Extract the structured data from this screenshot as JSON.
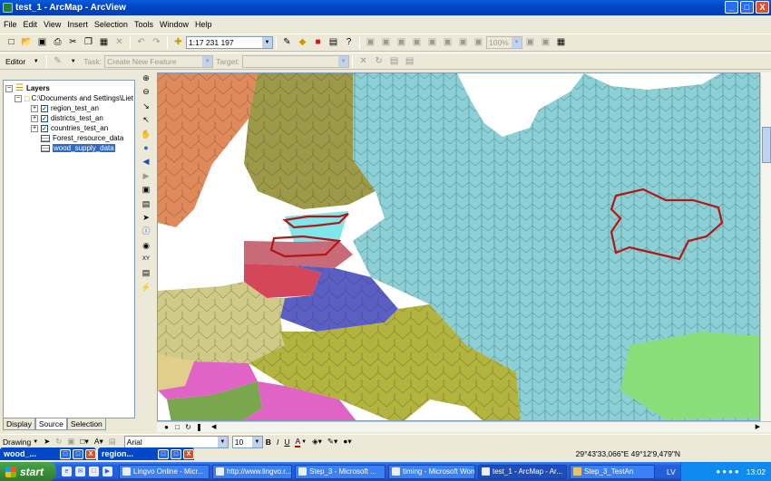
{
  "window": {
    "title": "test_1 - ArcMap - ArcView",
    "buttons": {
      "minimize": "_",
      "maximize": "□",
      "close": "X"
    }
  },
  "menu": [
    "File",
    "Edit",
    "View",
    "Insert",
    "Selection",
    "Tools",
    "Window",
    "Help"
  ],
  "standard_toolbar": {
    "scale": "1:17 231 197",
    "zoom_percent": "100%"
  },
  "editor_toolbar": {
    "editor_label": "Editor",
    "task_label": "Task:",
    "task_value": "Create New Feature",
    "target_label": "Target:",
    "target_value": ""
  },
  "toc": {
    "root": "Layers",
    "datasource": "C:\\Documents and Settings\\Liet",
    "layers": [
      {
        "name": "region_test_an",
        "checked": true
      },
      {
        "name": "districts_test_an",
        "checked": true
      },
      {
        "name": "countries_test_an",
        "checked": true
      }
    ],
    "tables": [
      {
        "name": "Forest_resource_data",
        "selected": false
      },
      {
        "name": "wood_supply_data",
        "selected": true
      }
    ],
    "tabs": [
      {
        "label": "Display",
        "active": false
      },
      {
        "label": "Source",
        "active": true
      },
      {
        "label": "Selection",
        "active": false
      }
    ]
  },
  "drawing_toolbar": {
    "drawing_label": "Drawing",
    "font": "Arial",
    "font_size": "10",
    "bold": "B",
    "italic": "I",
    "underline": "U",
    "font_color_label": "A"
  },
  "floating_windows": [
    {
      "title": "wood_..."
    },
    {
      "title": "region..."
    }
  ],
  "status": {
    "coordinates": "29°43'33,066\"E  49°12'9,479\"N"
  },
  "taskbar": {
    "start": "start",
    "tasks": [
      {
        "label": "Lingvo Online - Micr...",
        "active": false
      },
      {
        "label": "http://www.lingvo.r...",
        "active": false
      },
      {
        "label": "Step_3 - Microsoft ...",
        "active": false
      },
      {
        "label": "timing - Microsoft Word",
        "active": false
      },
      {
        "label": "test_1 - ArcMap - Ar...",
        "active": true
      },
      {
        "label": "Step_3_TestAn",
        "active": false
      }
    ],
    "language": "LV",
    "clock": "13:02"
  },
  "map_colors": {
    "ocean": "#ffffff",
    "russia": "#8cd0d6",
    "finland": "#9c9a48",
    "sweden": "#e08a5c",
    "estonia": "#7fe6ea",
    "latvia": "#c86a78",
    "lithuania": "#d6465a",
    "belarus": "#5b5fc4",
    "poland": "#cfcb86",
    "ukraine": "#b3b33f",
    "kazakhstan": "#8ade7a",
    "czech": "#e0ce8a",
    "slovakia": "#e064c6",
    "hungary": "#7aa64e",
    "highlight_outline": "#b01818"
  }
}
